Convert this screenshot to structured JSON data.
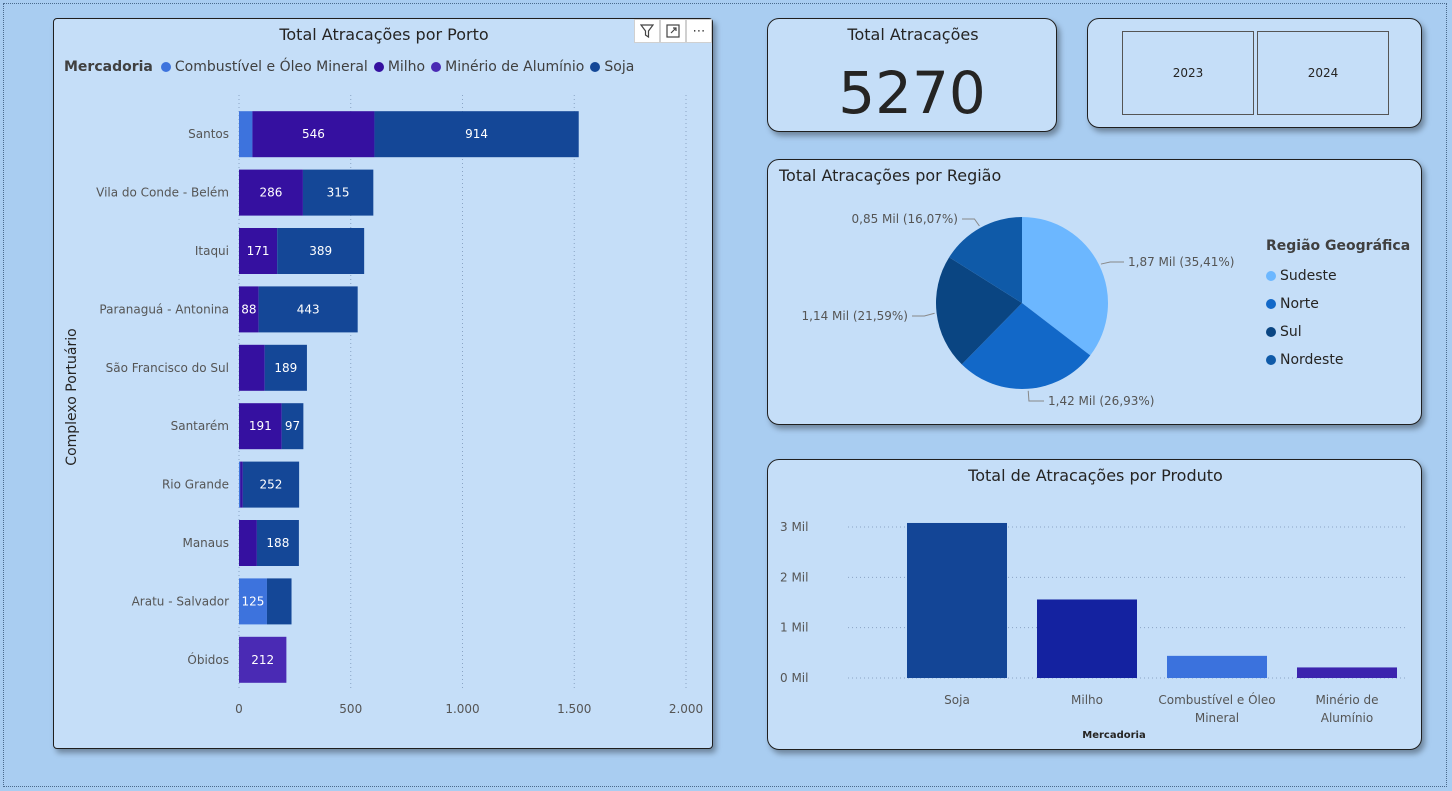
{
  "colors": {
    "combustivel": "#3d73dd",
    "milho": "#3510a0",
    "minerio": "#4a2ab4",
    "soja": "#144797",
    "sudeste": "#6cb7ff",
    "norte": "#1268c8",
    "sul": "#0a4582",
    "nordeste": "#0f5aa8",
    "bar_soja": "#134596",
    "bar_milho": "#1422a0",
    "bar_combustivel": "#3b72dd",
    "bar_minerio": "#3c24ae"
  },
  "toolbar": {
    "filter_icon": "filter-icon",
    "focus_icon": "focus-mode-icon",
    "more_icon": "more-options-icon",
    "more_label": "⋯"
  },
  "kpi": {
    "title": "Total Atracações",
    "value": "5270"
  },
  "slicer": {
    "options": [
      "2023",
      "2024"
    ]
  },
  "chart_data": [
    {
      "type": "bar",
      "orientation": "horizontal",
      "stacked": true,
      "title": "Total Atracações por Porto",
      "legend_title": "Mercadoria",
      "legend_position": "top-left",
      "ylabel": "Complexo Portuário",
      "xlim": [
        0,
        2000
      ],
      "xticks": [
        0,
        500,
        1000,
        1500,
        2000
      ],
      "xtick_labels": [
        "0",
        "500",
        "1.000",
        "1.500",
        "2.000"
      ],
      "grid": true,
      "categories": [
        "Santos",
        "Vila do Conde - Belém",
        "Itaqui",
        "Paranaguá - Antonina",
        "São Francisco do Sul",
        "Santarém",
        "Rio Grande",
        "Manaus",
        "Aratu - Salvador",
        "Óbidos"
      ],
      "series": [
        {
          "name": "Combustível e Óleo Mineral",
          "values": [
            60,
            0,
            0,
            0,
            0,
            0,
            5,
            0,
            125,
            0
          ]
        },
        {
          "name": "Milho",
          "values": [
            546,
            286,
            171,
            88,
            115,
            191,
            12,
            80,
            0,
            0
          ]
        },
        {
          "name": "Minério de Alumínio",
          "values": [
            0,
            0,
            0,
            0,
            0,
            0,
            0,
            0,
            0,
            212
          ]
        },
        {
          "name": "Soja",
          "values": [
            914,
            315,
            389,
            443,
            189,
            97,
            252,
            188,
            110,
            0
          ]
        }
      ],
      "data_labels": [
        [
          null,
          null,
          null,
          null,
          null,
          null,
          null,
          null,
          "125",
          null
        ],
        [
          "546",
          "286",
          "171",
          "88",
          null,
          "191",
          null,
          null,
          null,
          null
        ],
        [
          null,
          null,
          null,
          null,
          null,
          null,
          null,
          null,
          null,
          "212"
        ],
        [
          "914",
          "315",
          "389",
          "443",
          "189",
          "97",
          "252",
          "188",
          null,
          null
        ]
      ]
    },
    {
      "type": "pie",
      "title": "Total Atracações por Região",
      "legend_title": "Região Geográfica",
      "legend_position": "right",
      "categories": [
        "Sudeste",
        "Norte",
        "Sul",
        "Nordeste"
      ],
      "values": [
        35.41,
        26.93,
        21.59,
        16.07
      ],
      "data_labels": [
        "1,87 Mil (35,41%)",
        "1,42 Mil (26,93%)",
        "1,14 Mil (21,59%)",
        "0,85 Mil (16,07%)"
      ]
    },
    {
      "type": "bar",
      "title": "Total de Atracações por Produto",
      "xlabel": "Mercadoria",
      "categories": [
        "Soja",
        "Milho",
        "Combustível e Óleo Mineral",
        "Minério de Alumínio"
      ],
      "category_lines": [
        [
          "Soja"
        ],
        [
          "Milho"
        ],
        [
          "Combustível e Óleo",
          "Mineral"
        ],
        [
          "Minério de",
          "Alumínio"
        ]
      ],
      "values": [
        3080,
        1560,
        440,
        210
      ],
      "ylim": [
        0,
        3000
      ],
      "yticks": [
        0,
        1000,
        2000,
        3000
      ],
      "ytick_labels": [
        "0 Mil",
        "1 Mil",
        "2 Mil",
        "3 Mil"
      ],
      "grid": true
    }
  ]
}
